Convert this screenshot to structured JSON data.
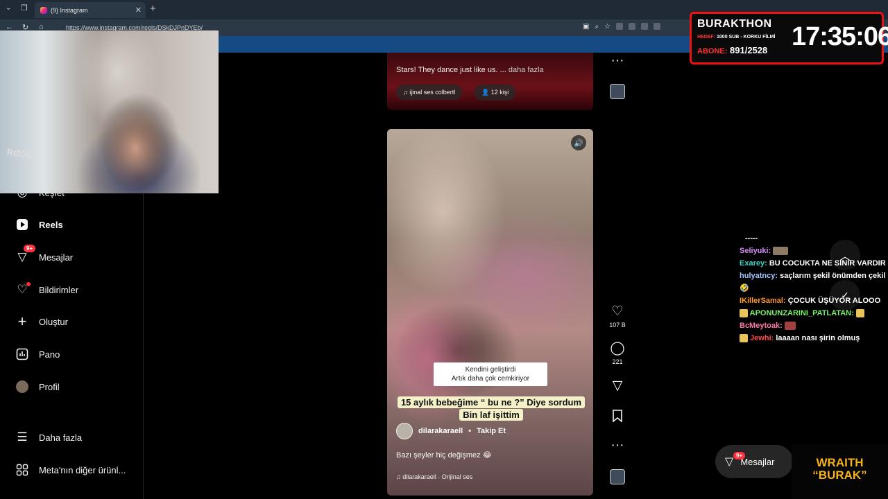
{
  "browser": {
    "tab_title": "(9) Instagram",
    "tab_close": "✕",
    "new_tab": "+",
    "url": "https://www.instagram.com/reels/DSkDJPnDYEb/"
  },
  "sidebar": {
    "items": [
      {
        "label": "Keşfet",
        "icon": "compass-icon"
      },
      {
        "label": "Reels",
        "icon": "reels-icon"
      },
      {
        "label": "Mesajlar",
        "icon": "messenger-icon",
        "badge": "9+"
      },
      {
        "label": "Bildirimler",
        "icon": "heart-icon"
      },
      {
        "label": "Oluştur",
        "icon": "plus-icon"
      },
      {
        "label": "Pano",
        "icon": "dashboard-icon"
      },
      {
        "label": "Profil",
        "icon": "profile-avatar"
      },
      {
        "label": "Daha fazla",
        "icon": "menu-icon"
      },
      {
        "label": "Meta'nın diğer ürünl...",
        "icon": "grid-icon"
      }
    ]
  },
  "reel_top": {
    "caption_text": "Stars! They dance just like us. ...",
    "caption_more": "daha fazla",
    "audio": "ijinal ses  colbertl",
    "people": "12 kişi"
  },
  "reel_main": {
    "subtitle_line1": "Kendini geliştirdi",
    "subtitle_line2": "Artık daha çok cemkiriyor",
    "title_line1": "15 aylık bebeğime “ bu ne ?” Diye sordum",
    "title_line2": "Bin laf işittim",
    "author": "dilarakaraell",
    "separator": "•",
    "follow": "Takip Et",
    "caption": "Bazı şeyler hiç değişmez 😂",
    "audio": "dilarakaraell · Orijinal ses"
  },
  "actions": {
    "likes": "107 B",
    "comments": "221"
  },
  "stream": {
    "name": "BURAKTHON",
    "goal_label": "HEDEF:",
    "goal_text": "1000 SUB - KORKU FİLMİ",
    "subs_label": "ABONE:",
    "subs_value": "891/2528",
    "time": "17:35:06"
  },
  "chat": {
    "divider": "-----",
    "messages": [
      {
        "user": "Seliyuki:",
        "text": "",
        "color": "#d38bf5",
        "emote": true
      },
      {
        "user": "Exarey:",
        "text": "BU COCUKTA NE SINIR VARDIR",
        "color": "#3fd3c4"
      },
      {
        "user": "hulyatncy:",
        "text": "saçlarım şekil önümden çekil 🤣",
        "color": "#9ec5ff"
      },
      {
        "user": "IKillerSamal:",
        "text": "ÇOCUK ÜŞÜYOR ALOOO",
        "color": "#ff9a2e"
      },
      {
        "user": "APONUNZARINI_PATLATAN:",
        "text": "",
        "color": "#7bf26b",
        "emote": true
      },
      {
        "user": "BcMeytoak:",
        "text": "",
        "color": "#ff7aa8",
        "emote": true
      },
      {
        "user": "Jewhi:",
        "text": "laaaan nası şirin olmuş",
        "color": "#ff4a4a"
      }
    ]
  },
  "floating": {
    "messages_label": "Mesajlar",
    "messages_badge": "9+"
  },
  "wraith": {
    "line1": "WRAITH",
    "line2": "“BURAK”"
  },
  "webcam": {
    "mic_brand": "RØDE"
  }
}
